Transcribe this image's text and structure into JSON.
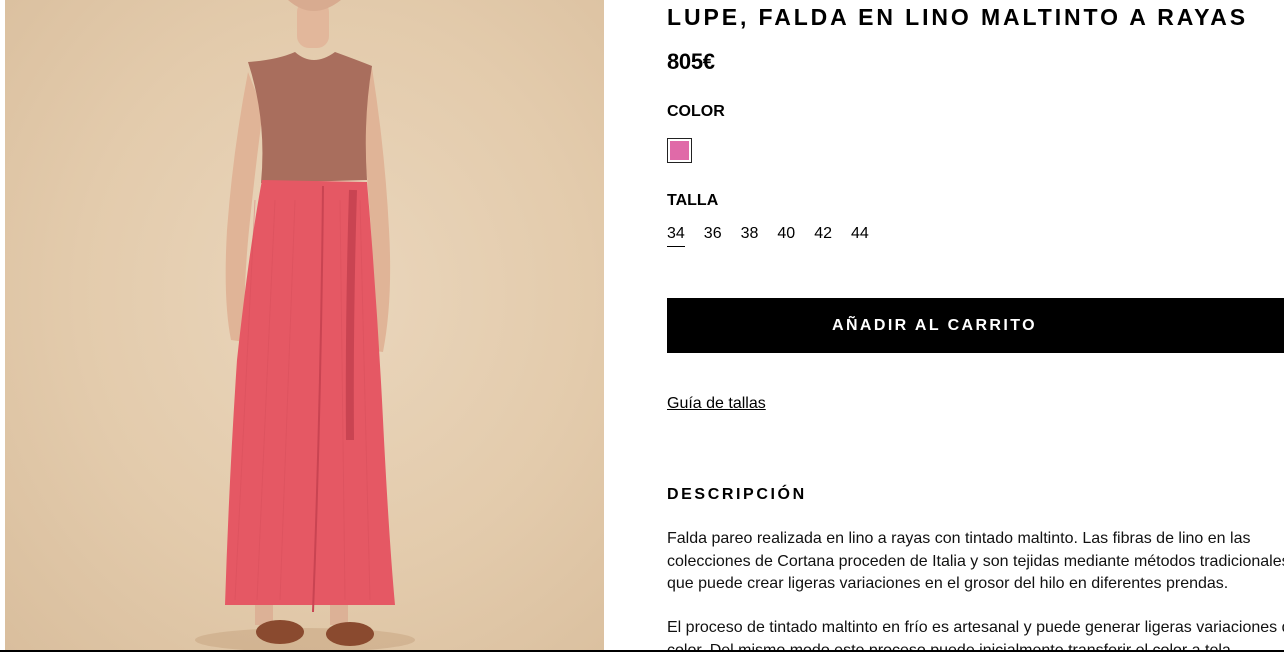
{
  "product": {
    "title": "LUPE, FALDA EN LINO MALTINTO A RAYAS",
    "price": "805€",
    "image_alt": "Model wearing a pink linen wrap skirt and a brown sleeveless top"
  },
  "color": {
    "label": "COLOR",
    "swatches": [
      {
        "hex": "#e06aa8",
        "selected": true
      }
    ]
  },
  "size": {
    "label": "TALLA",
    "options": [
      "34",
      "36",
      "38",
      "40",
      "42",
      "44"
    ],
    "selected": "34"
  },
  "cart": {
    "add_label": "AÑADIR AL CARRITO"
  },
  "size_guide": {
    "label": "Guía de tallas"
  },
  "description": {
    "label": "DESCRIPCIÓN",
    "paragraph1": [
      "Falda pareo realizada en lino a rayas con tintado maltinto. Las fibras de lino en las",
      "colecciones de Cortana proceden de Italia y son tejidas mediante métodos tradicionales,",
      "que puede crear ligeras variaciones en el grosor del hilo en diferentes prendas."
    ],
    "paragraph2": [
      "El proceso de tintado maltinto en frío es artesanal y puede generar ligeras variaciones de",
      "color. Del mismo modo este proceso puede inicialmente transferir el color a tela"
    ]
  },
  "colors": {
    "skirt": "#e55864",
    "top": "#a96e5d",
    "background": "#e6cfb2",
    "button": "#000000"
  }
}
